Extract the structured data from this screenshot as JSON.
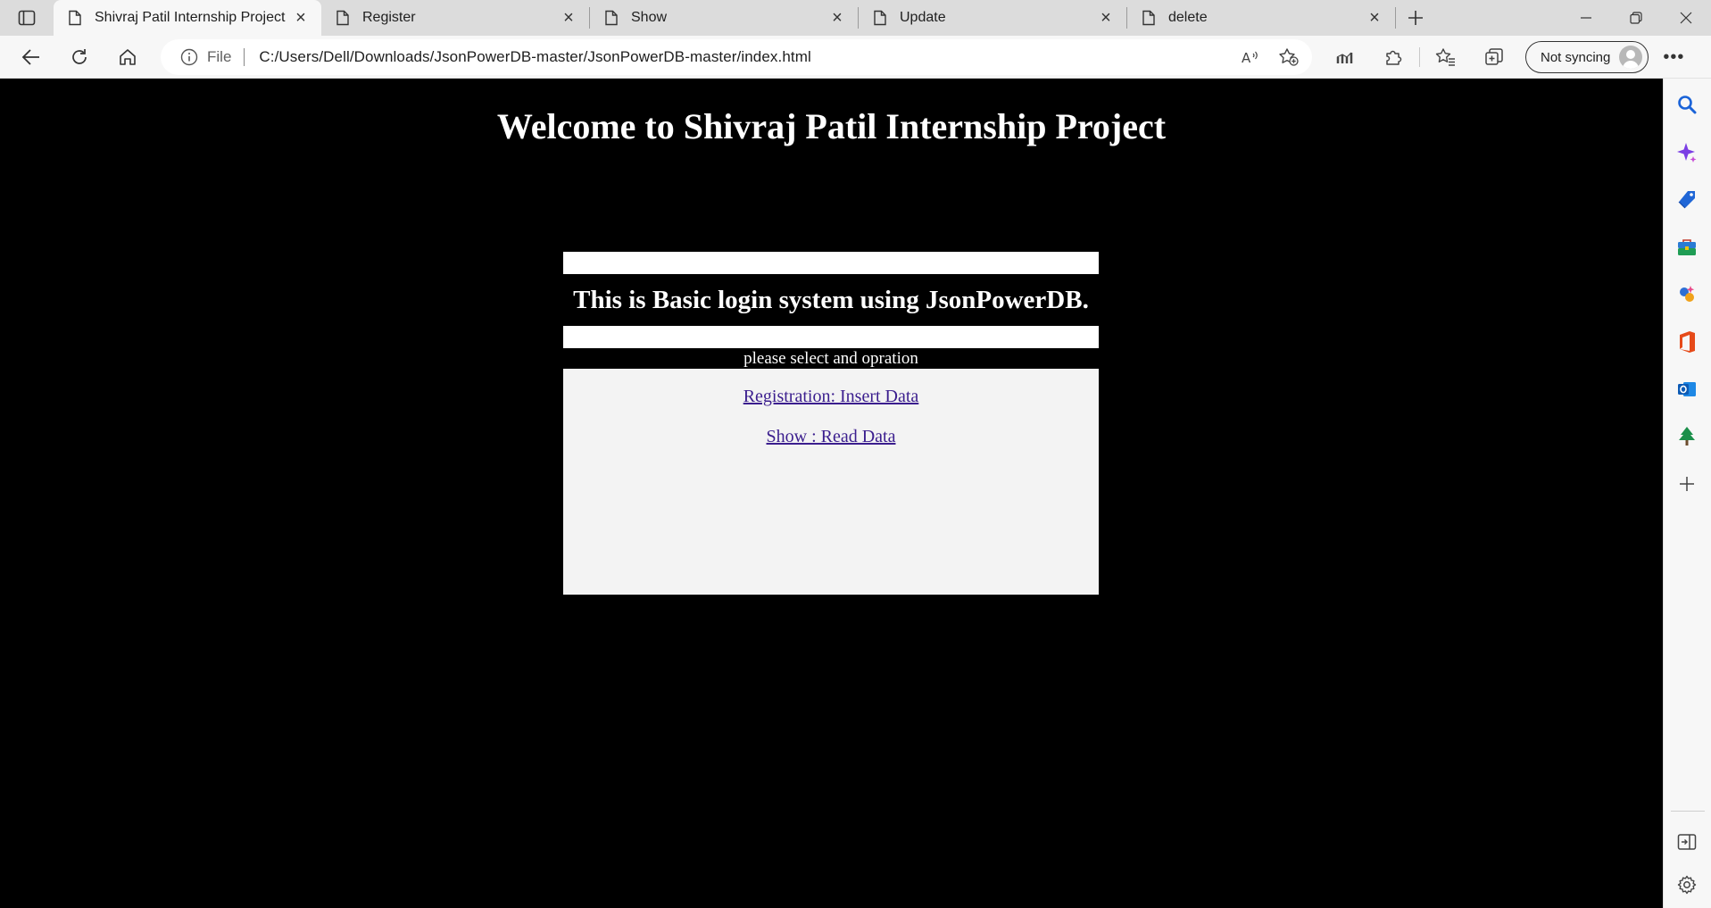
{
  "browser": {
    "tabs": [
      {
        "title": "Shivraj Patil Internship Project",
        "active": true
      },
      {
        "title": "Register",
        "active": false
      },
      {
        "title": "Show",
        "active": false
      },
      {
        "title": "Update",
        "active": false
      },
      {
        "title": "delete",
        "active": false
      }
    ],
    "address": {
      "scheme_label": "File",
      "url": "C:/Users/Dell/Downloads/JsonPowerDB-master/JsonPowerDB-master/index.html"
    },
    "profile_label": "Not syncing"
  },
  "page": {
    "heading": "Welcome to Shivraj Patil Internship Project",
    "subtitle": "This is Basic login system using JsonPowerDB.",
    "prompt": "please select and opration",
    "links": [
      {
        "label": "Registration: Insert Data"
      },
      {
        "label": "Show : Read Data"
      }
    ],
    "colors": {
      "background": "#000000",
      "link": "#3b1e8e",
      "panel": "#f3f3f3"
    }
  }
}
